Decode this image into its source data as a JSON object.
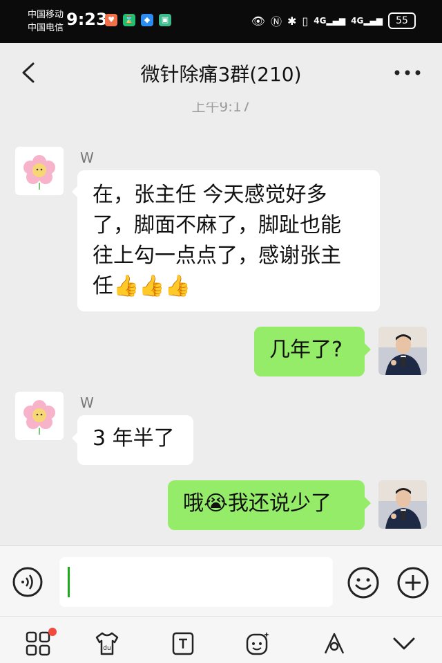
{
  "status_bar": {
    "carrier1": "中国移动",
    "carrier2": "中国电信",
    "time": "9:23",
    "signal1": "4G",
    "signal2": "4G",
    "battery": "55"
  },
  "header": {
    "title": "微针除痛3群(210)"
  },
  "chat": {
    "timestamp": "上午9:17",
    "messages": [
      {
        "side": "left",
        "sender": "W",
        "text1": "在，张主任  今天感觉好多",
        "text2": "了，脚面不麻了，脚趾也能",
        "text3": "往上勾一点点了，感谢张主",
        "text4": "任👍👍👍"
      },
      {
        "side": "right",
        "text": "几年了?"
      },
      {
        "side": "left",
        "sender": "W",
        "text": "3 年半了"
      },
      {
        "side": "right",
        "text": "哦😭我还说少了"
      }
    ]
  },
  "colors": {
    "bubble_self": "#95ec69",
    "bubble_other": "#ffffff",
    "background": "#ededed",
    "cursor": "#1aad19",
    "badge": "#f24a3f"
  },
  "icons": {
    "back": "chevron-left-icon",
    "more": "more-dots-icon",
    "voice": "voice-icon",
    "emoji": "emoji-icon",
    "plus": "plus-icon"
  }
}
